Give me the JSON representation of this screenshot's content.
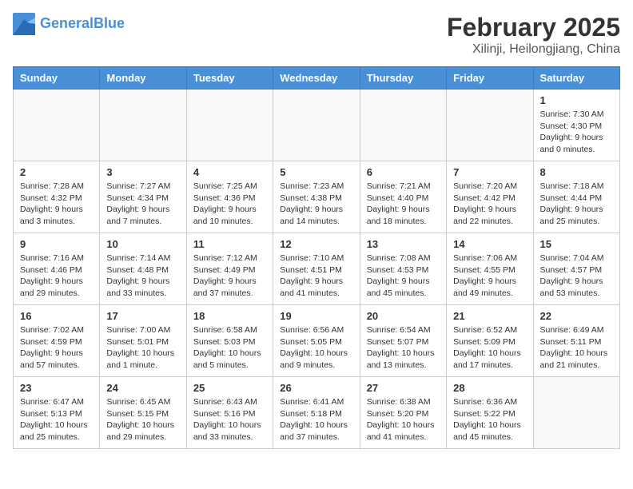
{
  "header": {
    "logo_line1": "General",
    "logo_line2": "Blue",
    "title": "February 2025",
    "subtitle": "Xilinji, Heilongjiang, China"
  },
  "weekdays": [
    "Sunday",
    "Monday",
    "Tuesday",
    "Wednesday",
    "Thursday",
    "Friday",
    "Saturday"
  ],
  "weeks": [
    [
      {
        "day": "",
        "info": ""
      },
      {
        "day": "",
        "info": ""
      },
      {
        "day": "",
        "info": ""
      },
      {
        "day": "",
        "info": ""
      },
      {
        "day": "",
        "info": ""
      },
      {
        "day": "",
        "info": ""
      },
      {
        "day": "1",
        "info": "Sunrise: 7:30 AM\nSunset: 4:30 PM\nDaylight: 9 hours and 0 minutes."
      }
    ],
    [
      {
        "day": "2",
        "info": "Sunrise: 7:28 AM\nSunset: 4:32 PM\nDaylight: 9 hours and 3 minutes."
      },
      {
        "day": "3",
        "info": "Sunrise: 7:27 AM\nSunset: 4:34 PM\nDaylight: 9 hours and 7 minutes."
      },
      {
        "day": "4",
        "info": "Sunrise: 7:25 AM\nSunset: 4:36 PM\nDaylight: 9 hours and 10 minutes."
      },
      {
        "day": "5",
        "info": "Sunrise: 7:23 AM\nSunset: 4:38 PM\nDaylight: 9 hours and 14 minutes."
      },
      {
        "day": "6",
        "info": "Sunrise: 7:21 AM\nSunset: 4:40 PM\nDaylight: 9 hours and 18 minutes."
      },
      {
        "day": "7",
        "info": "Sunrise: 7:20 AM\nSunset: 4:42 PM\nDaylight: 9 hours and 22 minutes."
      },
      {
        "day": "8",
        "info": "Sunrise: 7:18 AM\nSunset: 4:44 PM\nDaylight: 9 hours and 25 minutes."
      }
    ],
    [
      {
        "day": "9",
        "info": "Sunrise: 7:16 AM\nSunset: 4:46 PM\nDaylight: 9 hours and 29 minutes."
      },
      {
        "day": "10",
        "info": "Sunrise: 7:14 AM\nSunset: 4:48 PM\nDaylight: 9 hours and 33 minutes."
      },
      {
        "day": "11",
        "info": "Sunrise: 7:12 AM\nSunset: 4:49 PM\nDaylight: 9 hours and 37 minutes."
      },
      {
        "day": "12",
        "info": "Sunrise: 7:10 AM\nSunset: 4:51 PM\nDaylight: 9 hours and 41 minutes."
      },
      {
        "day": "13",
        "info": "Sunrise: 7:08 AM\nSunset: 4:53 PM\nDaylight: 9 hours and 45 minutes."
      },
      {
        "day": "14",
        "info": "Sunrise: 7:06 AM\nSunset: 4:55 PM\nDaylight: 9 hours and 49 minutes."
      },
      {
        "day": "15",
        "info": "Sunrise: 7:04 AM\nSunset: 4:57 PM\nDaylight: 9 hours and 53 minutes."
      }
    ],
    [
      {
        "day": "16",
        "info": "Sunrise: 7:02 AM\nSunset: 4:59 PM\nDaylight: 9 hours and 57 minutes."
      },
      {
        "day": "17",
        "info": "Sunrise: 7:00 AM\nSunset: 5:01 PM\nDaylight: 10 hours and 1 minute."
      },
      {
        "day": "18",
        "info": "Sunrise: 6:58 AM\nSunset: 5:03 PM\nDaylight: 10 hours and 5 minutes."
      },
      {
        "day": "19",
        "info": "Sunrise: 6:56 AM\nSunset: 5:05 PM\nDaylight: 10 hours and 9 minutes."
      },
      {
        "day": "20",
        "info": "Sunrise: 6:54 AM\nSunset: 5:07 PM\nDaylight: 10 hours and 13 minutes."
      },
      {
        "day": "21",
        "info": "Sunrise: 6:52 AM\nSunset: 5:09 PM\nDaylight: 10 hours and 17 minutes."
      },
      {
        "day": "22",
        "info": "Sunrise: 6:49 AM\nSunset: 5:11 PM\nDaylight: 10 hours and 21 minutes."
      }
    ],
    [
      {
        "day": "23",
        "info": "Sunrise: 6:47 AM\nSunset: 5:13 PM\nDaylight: 10 hours and 25 minutes."
      },
      {
        "day": "24",
        "info": "Sunrise: 6:45 AM\nSunset: 5:15 PM\nDaylight: 10 hours and 29 minutes."
      },
      {
        "day": "25",
        "info": "Sunrise: 6:43 AM\nSunset: 5:16 PM\nDaylight: 10 hours and 33 minutes."
      },
      {
        "day": "26",
        "info": "Sunrise: 6:41 AM\nSunset: 5:18 PM\nDaylight: 10 hours and 37 minutes."
      },
      {
        "day": "27",
        "info": "Sunrise: 6:38 AM\nSunset: 5:20 PM\nDaylight: 10 hours and 41 minutes."
      },
      {
        "day": "28",
        "info": "Sunrise: 6:36 AM\nSunset: 5:22 PM\nDaylight: 10 hours and 45 minutes."
      },
      {
        "day": "",
        "info": ""
      }
    ]
  ]
}
